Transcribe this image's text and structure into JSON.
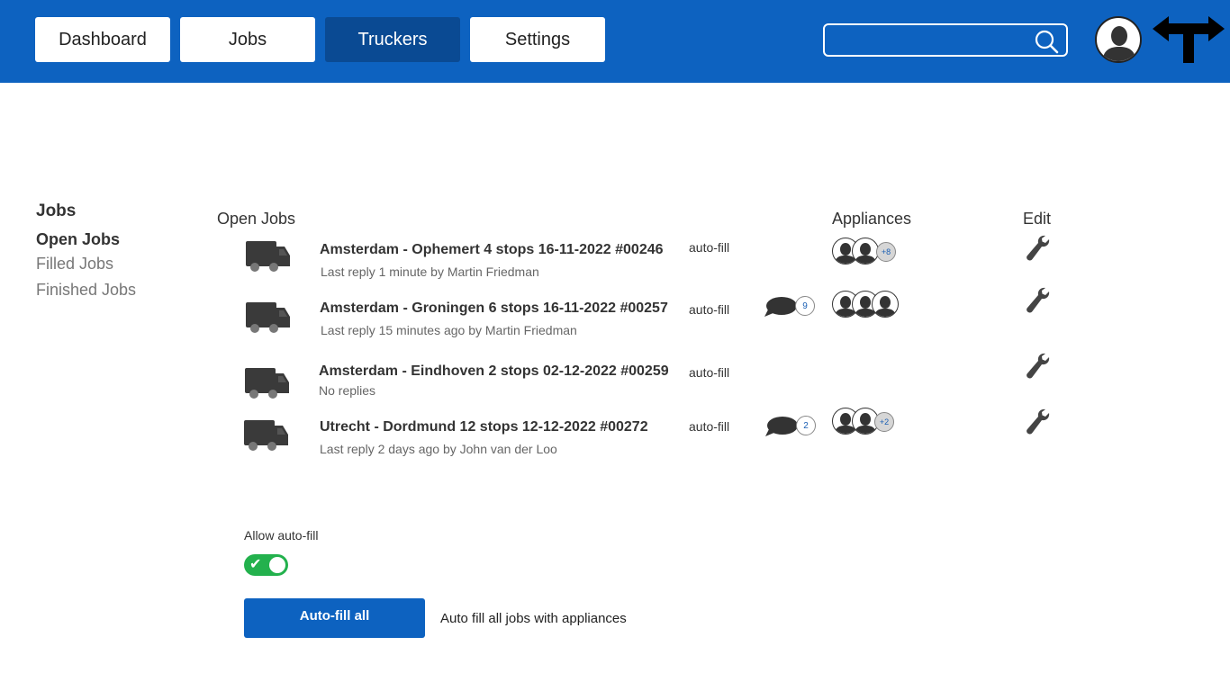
{
  "nav": {
    "items": [
      {
        "label": "Dashboard",
        "active": false
      },
      {
        "label": "Jobs",
        "active": false
      },
      {
        "label": "Truckers",
        "active": true
      },
      {
        "label": "Settings",
        "active": false
      }
    ],
    "search": {
      "value": "",
      "placeholder": ""
    },
    "icons": {
      "search": "search-icon",
      "avatar": "user-avatar-icon",
      "logo": "logo-t-arrows-icon"
    }
  },
  "colors": {
    "primary": "#0d62c0",
    "active_nav": "#0a4a93",
    "toggle_on": "#23b14d"
  },
  "sidebar": {
    "title": "Jobs",
    "items": [
      {
        "label": "Open Jobs",
        "active": true
      },
      {
        "label": "Filled Jobs",
        "active": false
      },
      {
        "label": "Finished Jobs",
        "active": false
      }
    ]
  },
  "table": {
    "headers": {
      "jobs": "Open Jobs",
      "appliances": "Appliances",
      "edit": "Edit"
    },
    "rows": [
      {
        "title": "Amsterdam - Ophemert 4 stops 16-11-2022 #00246",
        "subtitle": "Last reply 1 minute by Martin Friedman",
        "action": "auto-fill",
        "comments": null,
        "appliances_shown": 2,
        "appliances_more": "+8"
      },
      {
        "title": "Amsterdam - Groningen 6 stops 16-11-2022 #00257",
        "subtitle": "Last reply 15 minutes ago by Martin Friedman",
        "action": "auto-fill",
        "comments": "9",
        "appliances_shown": 3,
        "appliances_more": null
      },
      {
        "title": "Amsterdam - Eindhoven 2 stops 02-12-2022 #00259",
        "subtitle": "No replies",
        "action": "auto-fill",
        "comments": null,
        "appliances_shown": 0,
        "appliances_more": null
      },
      {
        "title": "Utrecht - Dordmund 12 stops 12-12-2022 #00272",
        "subtitle": "Last reply 2 days ago by John van der Loo",
        "action": "auto-fill",
        "comments": "2",
        "appliances_shown": 2,
        "appliances_more": "+2"
      }
    ]
  },
  "autofill": {
    "allow_label": "Allow auto-fill",
    "enabled": true,
    "button_label": "Auto-fill all",
    "description": "Auto fill all jobs with appliances"
  }
}
